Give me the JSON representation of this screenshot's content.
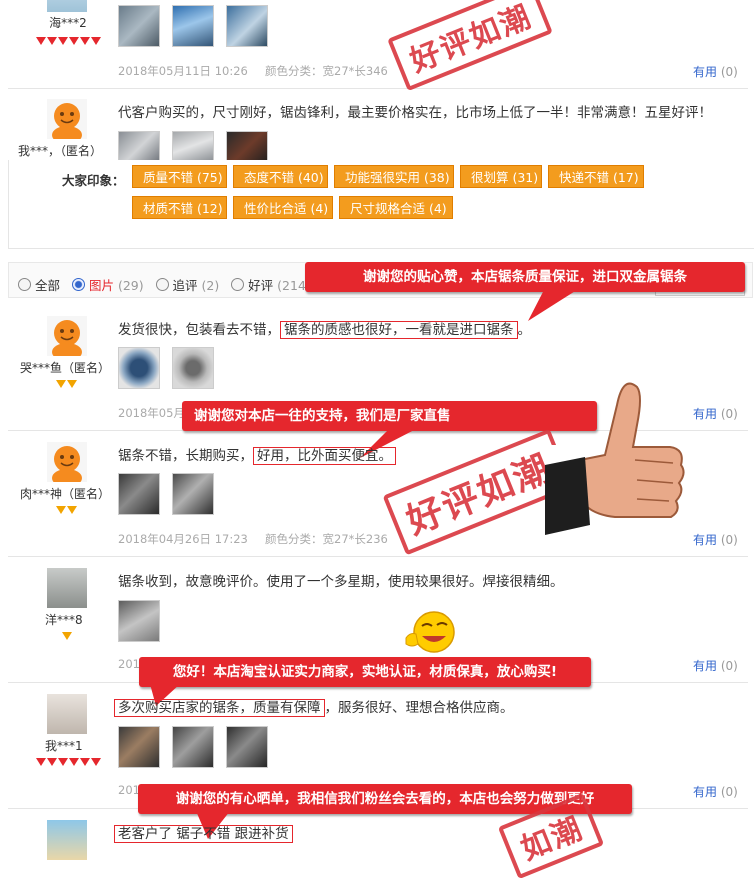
{
  "review1": {
    "user": "海***2",
    "date": "2018年05月11日 10:26",
    "attr": "颜色分类：宽27*长346",
    "useful": "有用",
    "count": "(0)"
  },
  "review2": {
    "user": "我***，（匿名）",
    "text": "代客户购买的，尺寸刚好，锯齿锋利，最主要价格实在，比市场上低了一半！非常满意！五星好评！"
  },
  "impressions": {
    "label": "大家印象：",
    "tags": [
      "质量不错 (75)",
      "态度不错 (40)",
      "功能强很实用 (38)",
      "很划算 (31)",
      "快递不错 (17)",
      "材质不错 (12)",
      "性价比合适 (4)",
      "尺寸规格合适 (4)"
    ]
  },
  "filters": {
    "all": "全部",
    "pics": "图片",
    "pics_count": "(29)",
    "append": "追评",
    "append_count": "(2)",
    "good": "好评",
    "good_count": "(214)"
  },
  "review3": {
    "user": "哭***鱼（匿名）",
    "text_a": "发货很快，包装看去不错，",
    "text_b": "锯条的质感也很好，一看就是进口锯条",
    "text_c": "。",
    "date": "2018年05月",
    "useful": "有用",
    "count": "(0)"
  },
  "review4": {
    "user": "肉***神（匿名）",
    "text_a": "锯条不错，长期购买，",
    "text_b": "好用，比外面买便宜。",
    "date": "2018年04月26日 17:23",
    "attr": "颜色分类：宽27*长236",
    "useful": "有用",
    "count": "(0)"
  },
  "review5": {
    "user": "洋***8",
    "text": "锯条收到，故意晚评价。使用了一个多星期，使用较果很好。焊接很精细。",
    "date": "201",
    "useful": "有用",
    "count": "(0)"
  },
  "review6": {
    "user": "我***1",
    "text_b": "多次购买店家的锯条，质量有保障",
    "text_a": "，服务很好、理想合格供应商。",
    "date": "201",
    "useful": "有用",
    "count": "(0)"
  },
  "review7": {
    "text": "老客户了 锯子不错 跟进补货"
  },
  "callouts": {
    "c1": "谢谢您的贴心赞，本店锯条质量保证，进口双金属锯条",
    "c2": "谢谢您对本店一往的支持，我们是厂家直售",
    "c3": "您好！本店淘宝认证实力商家，实地认证，材质保真，放心购买!",
    "c4": "谢谢您的有心晒单，我相信我们粉丝会去看的，本店也会努力做到更好"
  },
  "stamps": {
    "s1": "好评如潮",
    "s2": "好评如潮",
    "s3": "如潮"
  },
  "colors": {
    "accent_red": "#e5272d",
    "tag_orange": "#f39c1e",
    "link_blue": "#3366cc"
  }
}
